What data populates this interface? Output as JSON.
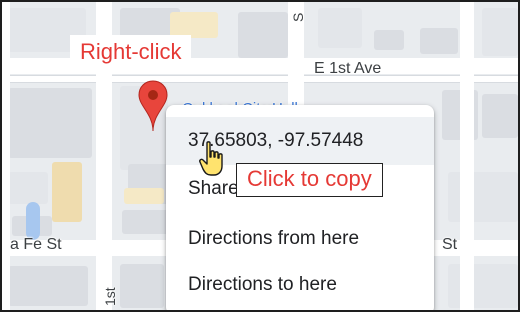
{
  "annotations": {
    "right_click_label": "Right-click",
    "click_to_copy_label": "Click to copy",
    "annotation_color": "#e53935"
  },
  "map": {
    "streets": {
      "east_first_ave": "E 1st Ave",
      "santa_fe_left": "a Fe St",
      "santa_fe_right": "St",
      "vertical_bottom": "1st",
      "top_fragment": "S"
    },
    "poi_label": "Oakland City Hall",
    "pin_color": "#e8453c",
    "poi_color": "#3b78d8"
  },
  "context_menu": {
    "coordinates": "37.65803, -97.57448",
    "share": "Share this location",
    "directions_from": "Directions from here",
    "directions_to": "Directions to here"
  },
  "icons": {
    "pin": "map-pin-icon",
    "cursor": "hand-pointer-cursor-icon"
  }
}
